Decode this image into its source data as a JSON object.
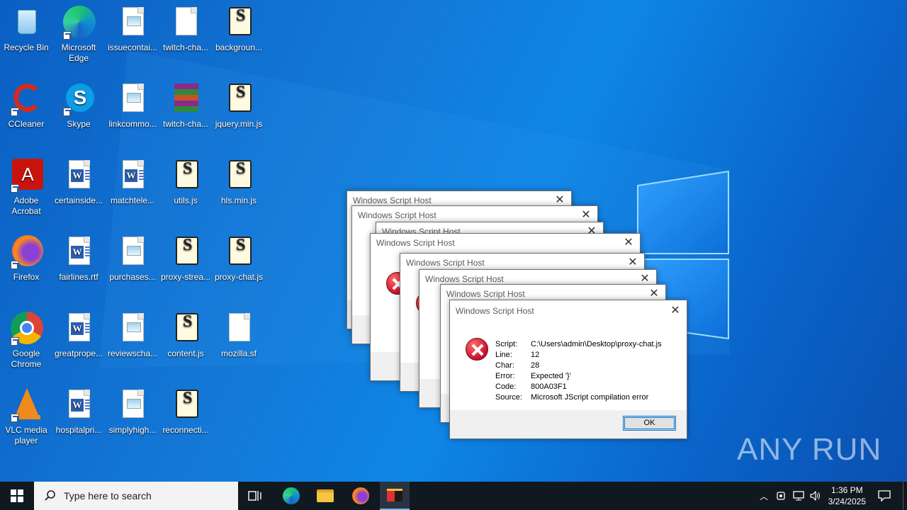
{
  "desktop": {
    "icons": [
      {
        "label": "Recycle Bin"
      },
      {
        "label": "Microsoft Edge"
      },
      {
        "label": "issuecontai..."
      },
      {
        "label": "twitch-cha..."
      },
      {
        "label": "backgroun..."
      },
      {
        "label": "CCleaner"
      },
      {
        "label": "Skype"
      },
      {
        "label": "linkcommo..."
      },
      {
        "label": "twitch-cha..."
      },
      {
        "label": "jquery.min.js"
      },
      {
        "label": "Adobe Acrobat"
      },
      {
        "label": "certainside..."
      },
      {
        "label": "matchtele..."
      },
      {
        "label": "utils.js"
      },
      {
        "label": "hls.min.js"
      },
      {
        "label": "Firefox"
      },
      {
        "label": "fairlines.rtf"
      },
      {
        "label": "purchases..."
      },
      {
        "label": "proxy-strea..."
      },
      {
        "label": "proxy-chat.js"
      },
      {
        "label": "Google Chrome"
      },
      {
        "label": "greatprope..."
      },
      {
        "label": "reviewscha..."
      },
      {
        "label": "content.js"
      },
      {
        "label": "mozilla.sf"
      },
      {
        "label": "VLC media player"
      },
      {
        "label": "hospitalpri..."
      },
      {
        "label": "simplyhigh..."
      },
      {
        "label": "reconnecti..."
      }
    ]
  },
  "dialogs": {
    "title": "Windows Script Host",
    "script_label": "Script:",
    "script_value": "C:\\Users\\admin\\Desktop\\proxy-chat.js",
    "line_label": "Line:",
    "line_value": "12",
    "char_label": "Char:",
    "char_value": "28",
    "error_label": "Error:",
    "error_value": "Expected '}'",
    "code_label": "Code:",
    "code_value": "800A03F1",
    "source_label": "Source:",
    "source_value": "Microsoft JScript compilation error",
    "ok_label": "OK"
  },
  "taskbar": {
    "search_placeholder": "Type here to search",
    "time": "1:36 PM",
    "date": "3/24/2025"
  },
  "watermark": "ANY RUN",
  "colors": {
    "accent": "#0078d7",
    "taskbar": "#101820",
    "error": "#c8102e"
  }
}
